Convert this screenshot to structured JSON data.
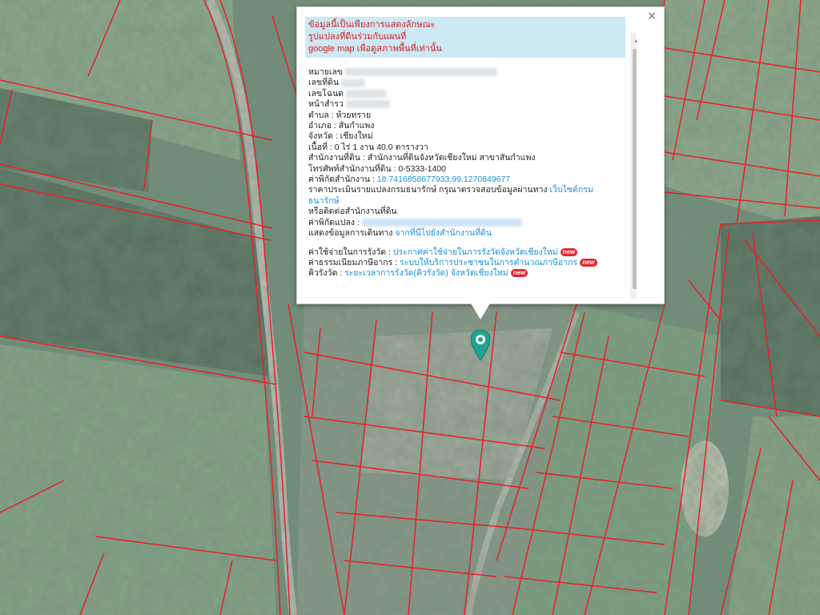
{
  "colors": {
    "parcel_line": "#e8202a",
    "notice_bg": "#cde9f4",
    "notice_text": "#d11f1f",
    "link": "#1a8fd6",
    "marker": "#1ea58f"
  },
  "popup": {
    "close_icon": "×",
    "notice": [
      "ข้อมูลนี้เป็นเพียงการแสดงลักษณะ",
      "รูปแปลงที่ดินร่วมกับแผนที่",
      "google map เพื่อดูสภาพพื้นที่เท่านั้น"
    ],
    "fields": {
      "deed_no_label": "หมายเลข",
      "land_no_label": "เลขที่ดิน",
      "survey_no_label": "เลขโฉนด",
      "page_label": "หน้าสำรว",
      "tambon": "ตำบล : ห้วยทราย",
      "amphoe": "อำเภอ : สันกำแพง",
      "changwat": "จังหวัด : เชียงใหม่",
      "area": "เนื้อที่ : 0 ไร่ 1 งาน 40.0 ตารางวา",
      "office": "สำนักงานที่ดิน : สำนักงานที่ดินจังหวัดเชียงใหม่ สาขาสันกำแพง",
      "office_phone": "โทรศัพท์สำนักงานที่ดิน : 0-5333-1400",
      "office_coords_label": "ค่าพิกัดสำนักงาน : ",
      "office_coords": "18.7416858677933,99.1270849677",
      "appraisal_text": "ราคาประเมินรายแปลงกรมธนารักษ์ กรุณาตรวจสอบข้อมูลผ่านทาง ",
      "appraisal_link": "เว็บไซต์กรมธนารักษ์",
      "contact_office": "หรือติดต่อสำนักงานที่ดิน",
      "parcel_coords_label": "ค่าพิกัดแปลง : ",
      "route_label": "แสดงข้อมูลการเดินทาง ",
      "route_link": "จากที่นี่ไปยังสำนักงานที่ดิน"
    },
    "footer": [
      {
        "label": "ค่าใช้จ่ายในการรังวัด : ",
        "link": "ประกาศค่าใช้จ่ายในการรังวัดจังหวัดเชียงใหม่",
        "badge": "new"
      },
      {
        "label": "ค่าธรรมเนียมภาษีอากร : ",
        "link": "ระบบให้บริการประชาชนในการคำนวณภาษีอากร",
        "badge": "new"
      },
      {
        "label": "คิวรังวัด : ",
        "link": "ระยะเวลาการรังวัด(คิวรังวัด) จังหวัดเชียงใหม่",
        "badge": "new"
      }
    ]
  }
}
